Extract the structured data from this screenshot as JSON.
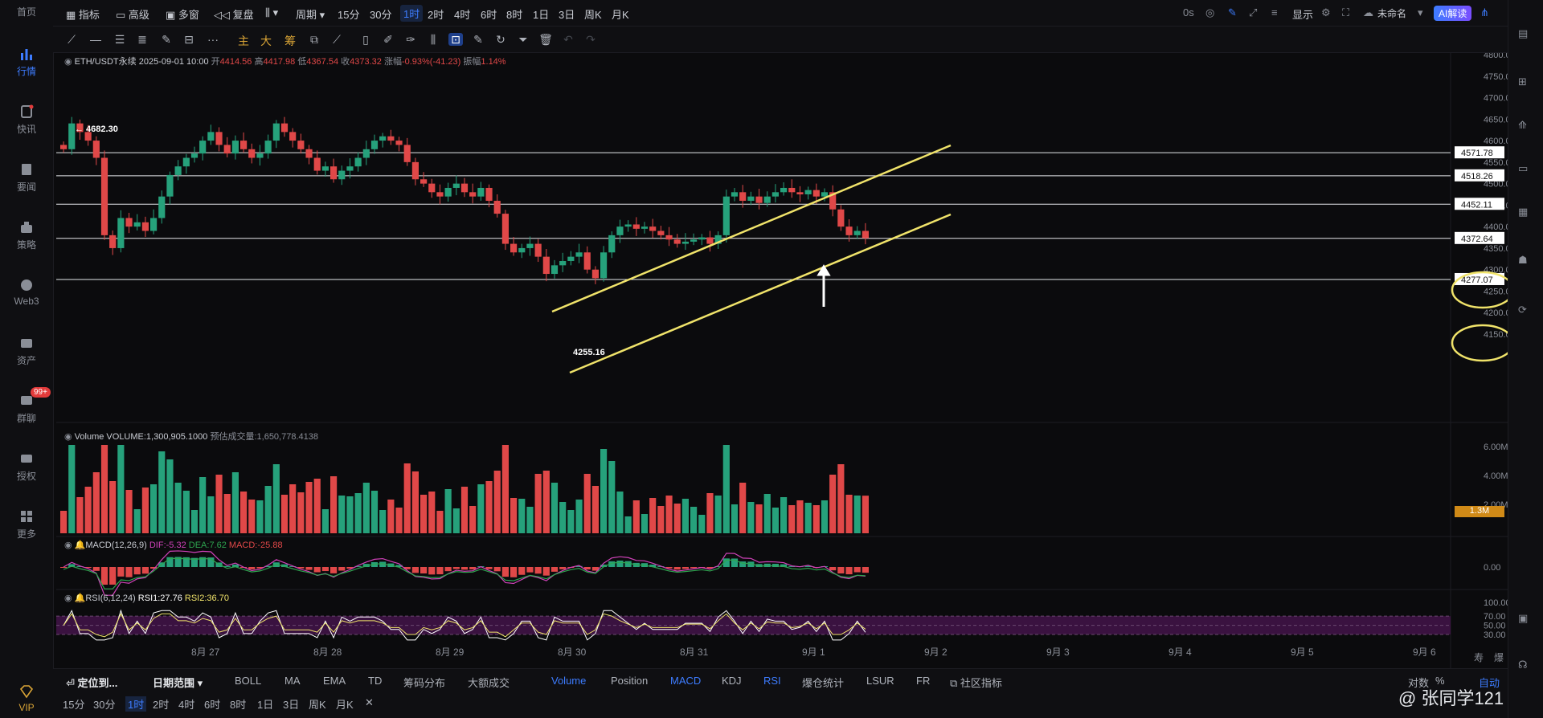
{
  "leftnav": {
    "items": [
      {
        "label": "首页",
        "icon": "home-icon"
      },
      {
        "label": "行情",
        "icon": "bar-chart-icon",
        "active": true
      },
      {
        "label": "快讯",
        "icon": "news-icon"
      },
      {
        "label": "要闻",
        "icon": "document-icon"
      },
      {
        "label": "策略",
        "icon": "strategy-icon"
      },
      {
        "label": "Web3",
        "icon": "web3-icon"
      },
      {
        "label": "资产",
        "icon": "wallet-icon"
      },
      {
        "label": "群聊",
        "icon": "chat-icon",
        "badge": "99+"
      },
      {
        "label": "授权",
        "icon": "key-icon"
      },
      {
        "label": "更多",
        "icon": "grid-icon"
      },
      {
        "label": "VIP",
        "icon": "diamond-icon"
      }
    ]
  },
  "topbar": {
    "indicator": "指标",
    "advanced": "高级",
    "multi": "多窗",
    "replay": "复盘",
    "period": "周期",
    "intervals": [
      "15分",
      "30分",
      "1时",
      "2时",
      "4时",
      "6时",
      "8时",
      "1日",
      "3日",
      "周K",
      "月K"
    ],
    "selected_interval": "1时",
    "timer": "0s",
    "display": "显示",
    "unnamed": "未命名",
    "ai": "AI解读"
  },
  "drawbar": {
    "main": "主",
    "big": "大",
    "chips": "筹"
  },
  "legend": {
    "symbol": "ETH/USDT永续",
    "datetime": "2025-09-01 10:00",
    "open_label": "开",
    "open": "4414.56",
    "high_label": "高",
    "high": "4417.98",
    "low_label": "低",
    "low": "4367.54",
    "close_label": "收",
    "close": "4373.32",
    "change_label": "涨幅",
    "change": "-0.93%(-41.23)",
    "amp_label": "振幅",
    "amp": "1.14%"
  },
  "chart_data": {
    "type": "candlestick",
    "price_axis": [
      "4800.00",
      "4750.00",
      "4700.00",
      "4650.00",
      "4600.00",
      "4550.00",
      "4500.00",
      "4450.00",
      "4400.00",
      "4350.00",
      "4300.00",
      "4250.00",
      "4200.00",
      "4150.00"
    ],
    "price_labels": [
      {
        "value": "4571.78"
      },
      {
        "value": "4518.26"
      },
      {
        "value": "4452.11"
      },
      {
        "value": "4372.64",
        "circled": true
      },
      {
        "value": "4277.07",
        "circled": true
      }
    ],
    "annotations": {
      "high": "← 4682.30",
      "low": "4255.16"
    },
    "dates": [
      "8月 27",
      "8月 28",
      "8月 29",
      "8月 30",
      "8月 31",
      "9月 1",
      "9月 2",
      "9月 3",
      "9月 4",
      "9月 5",
      "9月 6"
    ],
    "closes": [
      4580,
      4640,
      4620,
      4600,
      4560,
      4380,
      4350,
      4420,
      4400,
      4410,
      4390,
      4420,
      4470,
      4520,
      4540,
      4560,
      4570,
      4600,
      4620,
      4590,
      4570,
      4600,
      4580,
      4560,
      4570,
      4600,
      4640,
      4620,
      4600,
      4580,
      4560,
      4530,
      4540,
      4510,
      4530,
      4540,
      4560,
      4580,
      4600,
      4610,
      4600,
      4590,
      4550,
      4510,
      4500,
      4480,
      4470,
      4490,
      4500,
      4480,
      4470,
      4490,
      4460,
      4430,
      4360,
      4340,
      4350,
      4360,
      4330,
      4290,
      4310,
      4320,
      4330,
      4340,
      4300,
      4280,
      4340,
      4380,
      4400,
      4405,
      4395,
      4400,
      4390,
      4380,
      4370,
      4360,
      4365,
      4370,
      4375,
      4360,
      4380,
      4470,
      4480,
      4460,
      4470,
      4455,
      4470,
      4480,
      4490,
      4480,
      4475,
      4485,
      4470,
      4480,
      4440,
      4400,
      4380,
      4390,
      4373
    ],
    "volume": {
      "label": "Volume",
      "value_label": "VOLUME:1,300,905.1000",
      "est_label": "预估成交量:1,650,778.4138",
      "axis": [
        "6.00M",
        "4.00M",
        "2.00M"
      ],
      "current": "1.3M"
    },
    "macd": {
      "label": "MACD(12,26,9)",
      "dif": "DIF:-5.32",
      "dea": "DEA:7.62",
      "macd": "MACD:-25.88",
      "axis": [
        "0.00"
      ]
    },
    "rsi": {
      "label": "RSI(6,12,24)",
      "rsi1": "RSI1:27.76",
      "rsi2": "RSI2:36.70",
      "axis": [
        "100.00",
        "70.00",
        "50.00",
        "30.00"
      ]
    }
  },
  "bottom": {
    "locate": "定位到...",
    "date_range": "日期范围",
    "indicators": [
      "BOLL",
      "MA",
      "EMA",
      "TD",
      "筹码分布",
      "大额成交"
    ],
    "sub_indicators": [
      "Volume",
      "Position",
      "MACD",
      "KDJ",
      "RSI",
      "爆仓统计",
      "LSUR",
      "FR"
    ],
    "community": "社区指标",
    "scale": [
      "对数",
      "%",
      "自动"
    ],
    "intervals": [
      "15分",
      "30分",
      "1时",
      "2时",
      "4时",
      "6时",
      "8时",
      "1日",
      "3日",
      "周K",
      "月K"
    ],
    "axis_corner": [
      "寿",
      "爆"
    ]
  },
  "watermark": "@ 张同学121"
}
